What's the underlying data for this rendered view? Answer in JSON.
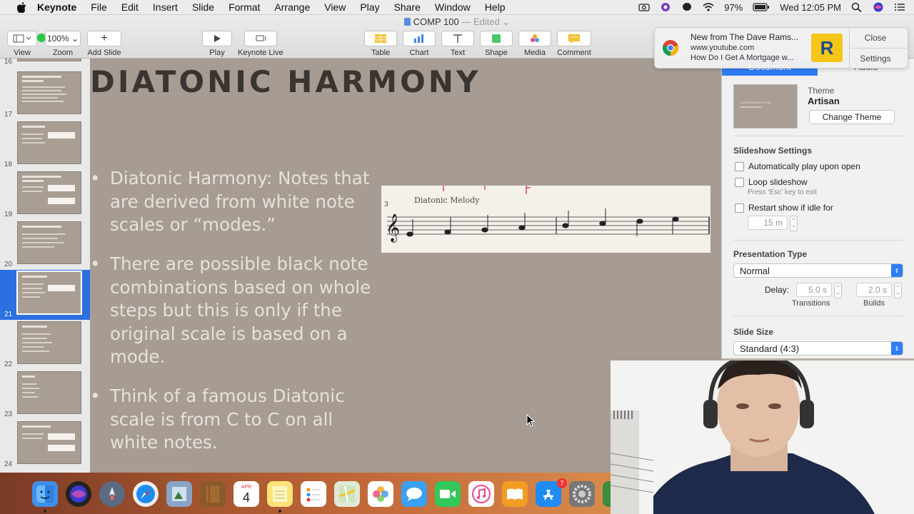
{
  "menubar": {
    "app": "Keynote",
    "items": [
      "File",
      "Edit",
      "Insert",
      "Slide",
      "Format",
      "Arrange",
      "View",
      "Play",
      "Share",
      "Window",
      "Help"
    ],
    "battery": "97%",
    "clock": "Wed 12:05 PM"
  },
  "window": {
    "title": "COMP 100",
    "edited": "— Edited"
  },
  "toolbar": {
    "view": "View",
    "zoom_value": "100%",
    "zoom": "Zoom",
    "add_slide": "Add Slide",
    "play": "Play",
    "keynote_live": "Keynote Live",
    "table": "Table",
    "chart": "Chart",
    "text": "Text",
    "shape": "Shape",
    "media": "Media",
    "comment": "Comment"
  },
  "navigator": {
    "slides": [
      {
        "num": "16"
      },
      {
        "num": "17"
      },
      {
        "num": "18"
      },
      {
        "num": "19"
      },
      {
        "num": "20"
      },
      {
        "num": "21"
      },
      {
        "num": "22"
      },
      {
        "num": "23"
      },
      {
        "num": "24"
      }
    ],
    "selected": "21"
  },
  "slide": {
    "title": "DIATONIC HARMONY",
    "bullets": [
      "Diatonic Harmony: Notes that are derived from white note scales or “modes.”",
      "There are possible black note combinations based on whole steps but this is only if the original scale is based on a mode.",
      "Think of a famous Diatonic scale is from C to C on all white notes."
    ],
    "bullet_dot": "•",
    "score_caption": "Diatonic Melody",
    "score_measure": "3"
  },
  "inspector": {
    "tab_document": "Document",
    "tab_audio": "Audio",
    "theme_label": "Theme",
    "theme_name": "Artisan",
    "theme_thumb_text": "LOREM IPSUM DOLOR",
    "change_theme": "Change Theme",
    "slideshow_settings": "Slideshow Settings",
    "auto_play": "Automatically play upon open",
    "loop": "Loop slideshow",
    "loop_hint": "Press ‘Esc’ key to exit",
    "restart": "Restart show if idle for",
    "idle_value": "15 m",
    "presentation_type": "Presentation Type",
    "presentation_value": "Normal",
    "delay": "Delay:",
    "transitions_value": "5.0 s",
    "builds_value": "2.0 s",
    "transitions": "Transitions",
    "builds": "Builds",
    "slide_size": "Slide Size",
    "slide_size_value": "Standard (4:3)"
  },
  "notification": {
    "title": "New from The Dave Rams...",
    "source": "www.youtube.com",
    "body": "How Do I Get A Mortgage w...",
    "close": "Close",
    "settings": "Settings",
    "thumb_letter": "R"
  },
  "dock": {
    "calendar_month": "APR",
    "calendar_day": "4",
    "appstore_badge": "7"
  },
  "colors": {
    "slide_bg": "#a69c93",
    "selection": "#2b6fe0",
    "accent": "#2f7df6"
  }
}
